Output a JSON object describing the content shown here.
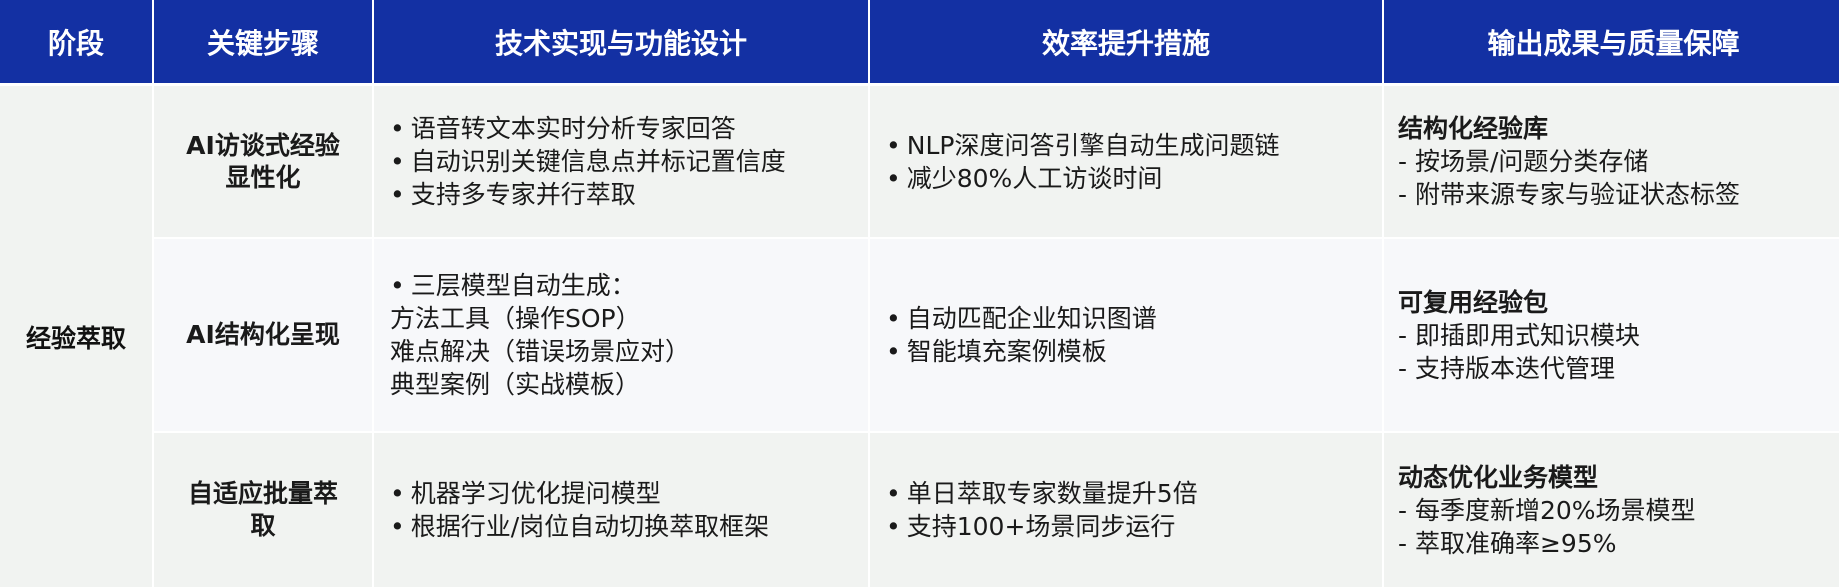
{
  "header": [
    "阶段",
    "关键步骤",
    "技术实现与功能设计",
    "效率提升措施",
    "输出成果与质量保障"
  ],
  "stage": "经验萃取",
  "rows": [
    {
      "step": [
        "AI访谈式经验",
        "显性化"
      ],
      "tech": [
        "语音转文本实时分析专家回答",
        "自动识别关键信息点并标记置信度",
        "支持多专家并行萃取"
      ],
      "efficiency": [
        "NLP深度问答引擎自动生成问题链",
        "减少80%人工访谈时间"
      ],
      "output_title": "结构化经验库",
      "output": [
        "按场景/问题分类存储",
        "附带来源专家与验证状态标签"
      ]
    },
    {
      "step": [
        "AI结构化呈现"
      ],
      "tech_bullet": "三层模型自动生成：",
      "tech_sub": [
        "方法工具（操作SOP）",
        "难点解决（错误场景应对）",
        "典型案例（实战模板）"
      ],
      "efficiency": [
        "自动匹配企业知识图谱",
        "智能填充案例模板"
      ],
      "output_title": "可复用经验包",
      "output": [
        "即插即用式知识模块",
        "支持版本迭代管理"
      ]
    },
    {
      "step": [
        "自适应批量萃",
        "取"
      ],
      "tech": [
        "机器学习优化提问模型",
        "根据行业/岗位自动切换萃取框架"
      ],
      "efficiency": [
        "单日萃取专家数量提升5倍",
        "支持100+场景同步运行"
      ],
      "output_title": "动态优化业务模型",
      "output": [
        "每季度新增20%场景模型",
        "萃取准确率≥95%"
      ]
    }
  ],
  "colors": {
    "header_bg": "#1330a3",
    "row_bg_a": "#f1f3f1",
    "row_bg_b": "#f7f8fa"
  }
}
